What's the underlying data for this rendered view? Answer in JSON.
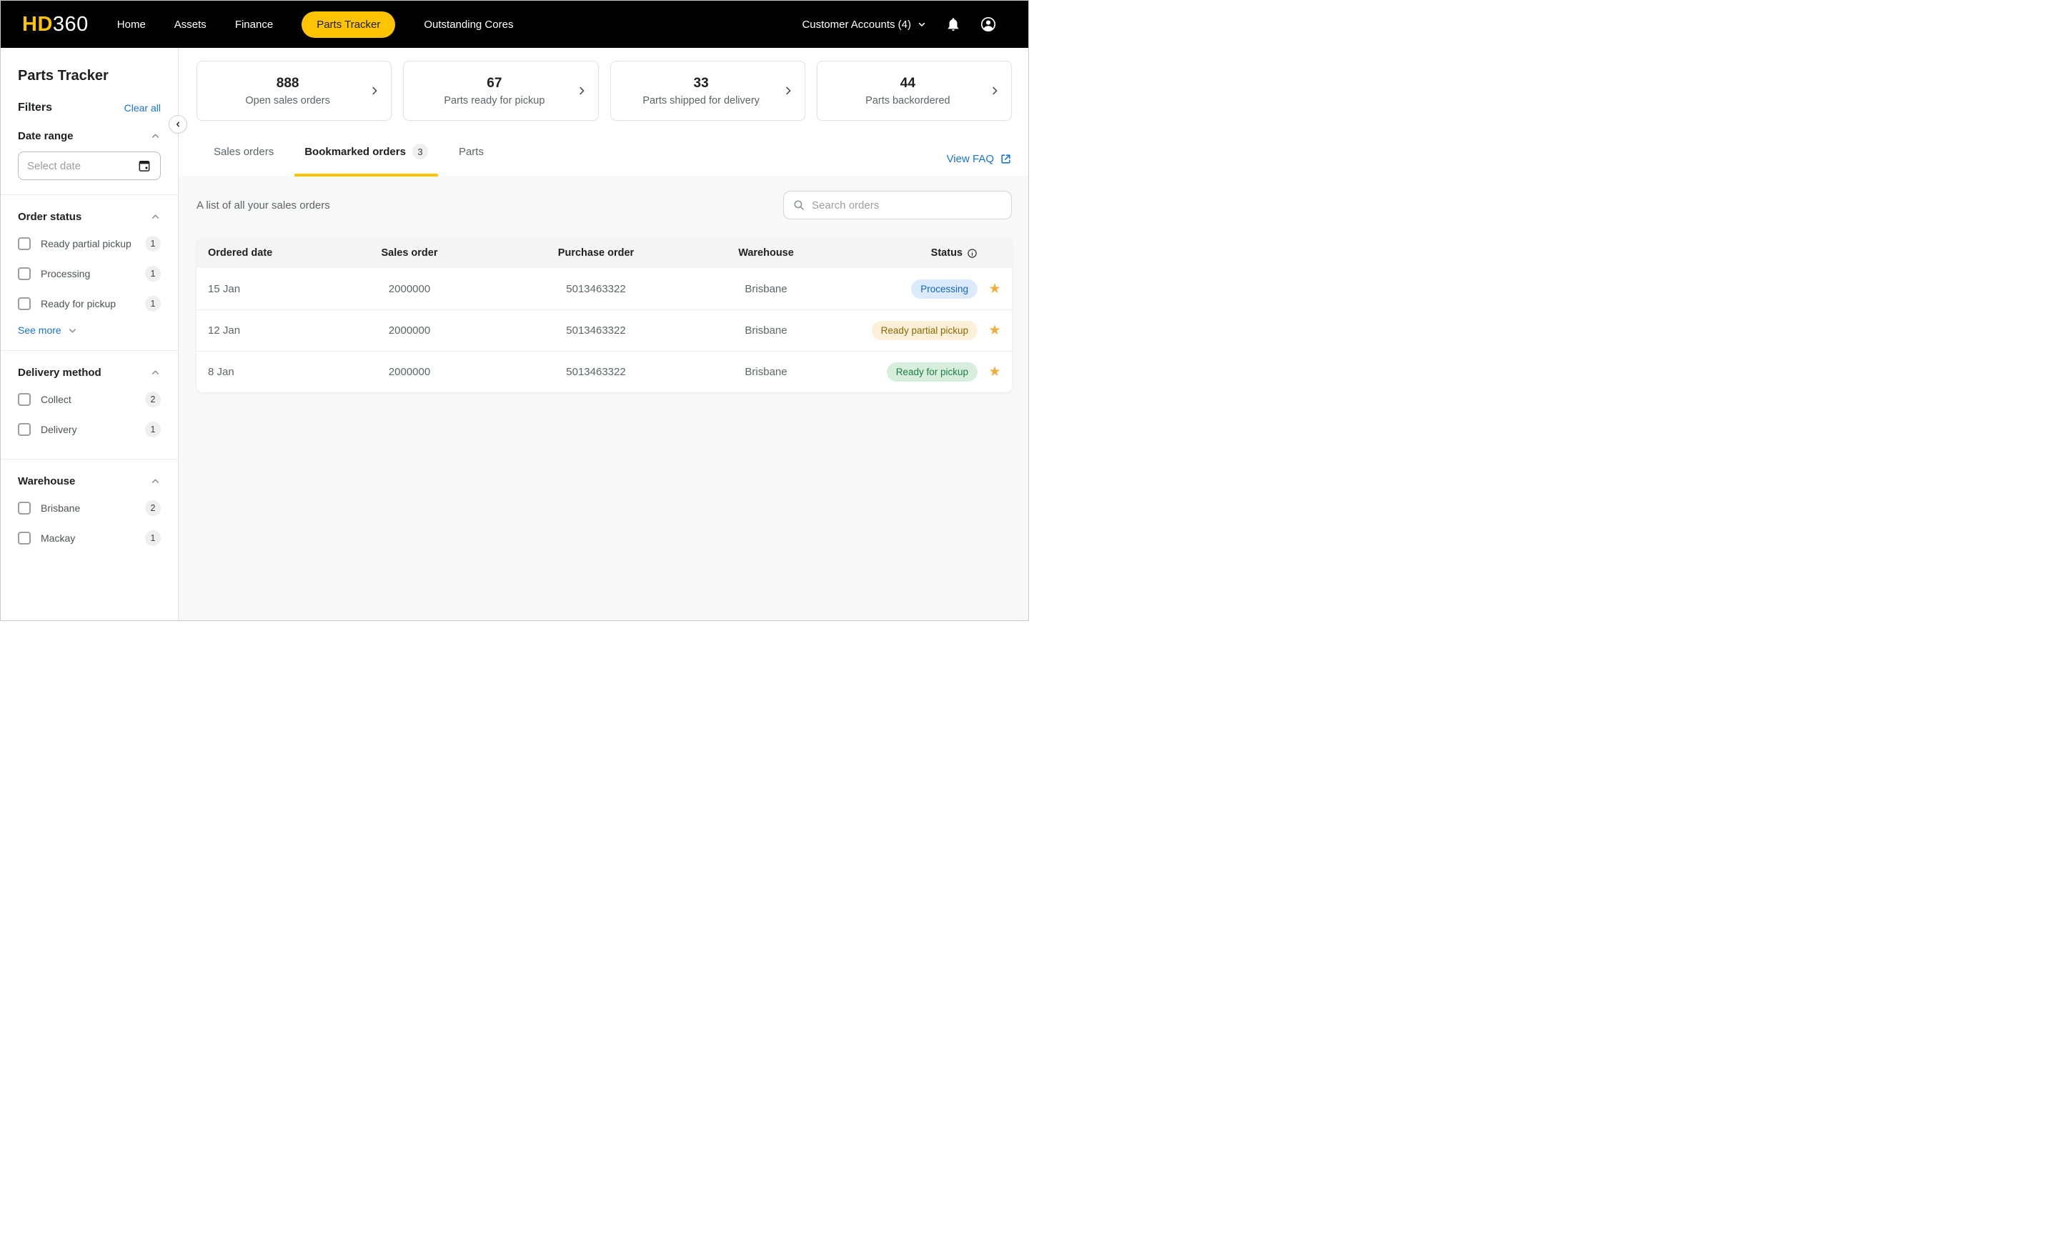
{
  "colors": {
    "accent": "#FFC400",
    "nav-bg": "#000000",
    "link": "#1973D2",
    "text-dark": "#202124",
    "text-grey": "#5F6368",
    "star": "#F2AC3C",
    "pill-processing-bg": "#DCEBFB",
    "pill-processing-text": "#1565C0",
    "pill-partial-bg": "#FCF0D9",
    "pill-partial-text": "#8C6900",
    "pill-ready-bg": "#D7EDDE",
    "pill-ready-text": "#1F7E44"
  },
  "icons": {
    "star": "★"
  },
  "nav": {
    "logo_primary": "HD",
    "logo_secondary": "360",
    "items": [
      {
        "label": "Home"
      },
      {
        "label": "Assets"
      },
      {
        "label": "Finance"
      },
      {
        "label": "Parts Tracker",
        "active": true
      },
      {
        "label": "Outstanding Cores"
      }
    ],
    "account_menu_label": "Customer Accounts (4)"
  },
  "sidebar": {
    "title": "Parts Tracker",
    "filters_label": "Filters",
    "clear_all_label": "Clear all",
    "date_range_label": "Date range",
    "date_placeholder": "Select date",
    "sections": [
      {
        "label": "Order status",
        "items": [
          {
            "label": "Ready partial pickup",
            "count": "1"
          },
          {
            "label": "Processing",
            "count": "1"
          },
          {
            "label": "Ready for pickup",
            "count": "1"
          }
        ],
        "see_more_label": "See more"
      },
      {
        "label": "Delivery method",
        "items": [
          {
            "label": "Collect",
            "count": "2"
          },
          {
            "label": "Delivery",
            "count": "1"
          }
        ]
      },
      {
        "label": "Warehouse",
        "items": [
          {
            "label": "Brisbane",
            "count": "2"
          },
          {
            "label": "Mackay",
            "count": "1"
          }
        ]
      }
    ]
  },
  "summary_cards": [
    {
      "value": "888",
      "label": "Open sales orders"
    },
    {
      "value": "67",
      "label": "Parts ready for pickup"
    },
    {
      "value": "33",
      "label": "Parts shipped for delivery"
    },
    {
      "value": "44",
      "label": "Parts backordered"
    }
  ],
  "tabs": [
    {
      "label": "Sales orders"
    },
    {
      "label": "Bookmarked orders",
      "badge": "3",
      "active": true
    },
    {
      "label": "Parts"
    }
  ],
  "faq_link_label": "View FAQ",
  "orders": {
    "caption": "A list of all your sales orders",
    "search_placeholder": "Search orders",
    "columns": [
      "Ordered date",
      "Sales order",
      "Purchase order",
      "Warehouse",
      "Status"
    ],
    "rows": [
      {
        "ordered_date": "15 Jan",
        "sales_order": "2000000",
        "purchase_order": "5013463322",
        "warehouse": "Brisbane",
        "status": "Processing",
        "bookmarked": true
      },
      {
        "ordered_date": "12 Jan",
        "sales_order": "2000000",
        "purchase_order": "5013463322",
        "warehouse": "Brisbane",
        "status": "Ready partial pickup",
        "bookmarked": true
      },
      {
        "ordered_date": "8 Jan",
        "sales_order": "2000000",
        "purchase_order": "5013463322",
        "warehouse": "Brisbane",
        "status": "Ready for pickup",
        "bookmarked": true
      }
    ]
  }
}
